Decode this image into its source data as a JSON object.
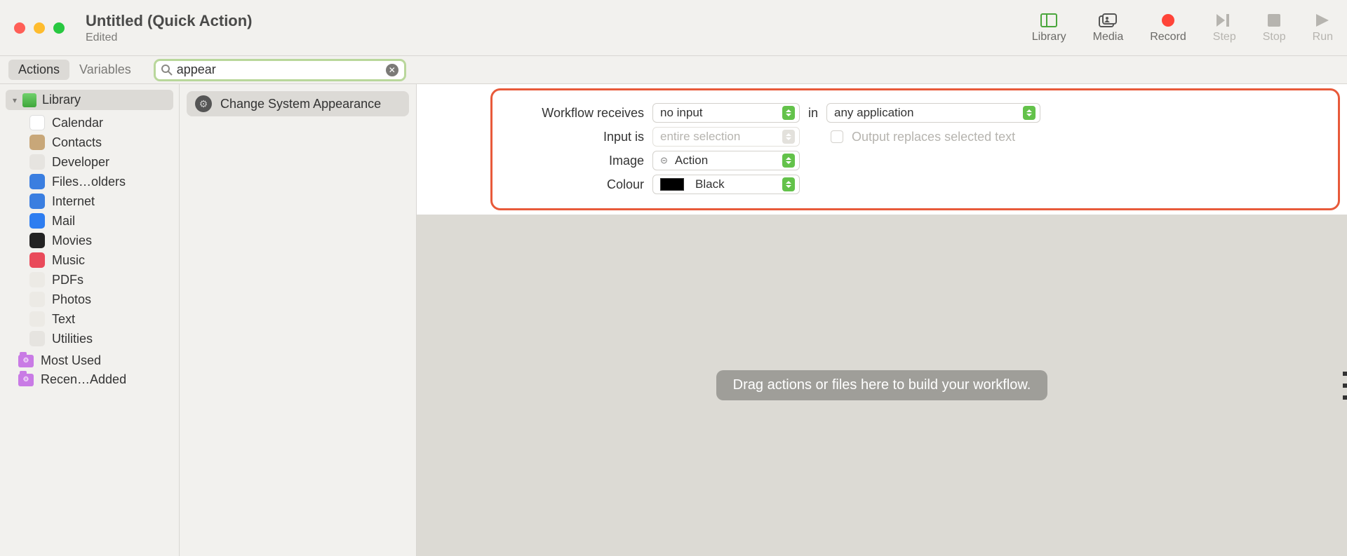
{
  "window": {
    "title": "Untitled (Quick Action)",
    "subtitle": "Edited"
  },
  "toolbar": {
    "library": "Library",
    "media": "Media",
    "record": "Record",
    "step": "Step",
    "stop": "Stop",
    "run": "Run"
  },
  "tabs": {
    "actions": "Actions",
    "variables": "Variables"
  },
  "search": {
    "value": "appear"
  },
  "sidebar": {
    "library_label": "Library",
    "categories": [
      {
        "label": "Calendar",
        "icon": "cal"
      },
      {
        "label": "Contacts",
        "icon": "con"
      },
      {
        "label": "Developer",
        "icon": "dev"
      },
      {
        "label": "Files…olders",
        "icon": "fil"
      },
      {
        "label": "Internet",
        "icon": "int"
      },
      {
        "label": "Mail",
        "icon": "mai"
      },
      {
        "label": "Movies",
        "icon": "mov"
      },
      {
        "label": "Music",
        "icon": "mus"
      },
      {
        "label": "PDFs",
        "icon": "pdf"
      },
      {
        "label": "Photos",
        "icon": "pho"
      },
      {
        "label": "Text",
        "icon": "txt"
      },
      {
        "label": "Utilities",
        "icon": "uti"
      }
    ],
    "smart": [
      {
        "label": "Most Used"
      },
      {
        "label": "Recen…Added"
      }
    ]
  },
  "actions": {
    "results": [
      {
        "label": "Change System Appearance"
      }
    ]
  },
  "config": {
    "rows": {
      "workflow_receives": {
        "label": "Workflow receives",
        "value": "no input",
        "after": "in",
        "value2": "any application"
      },
      "input_is": {
        "label": "Input is",
        "value": "entire selection",
        "checkbox_label": "Output replaces selected text"
      },
      "image": {
        "label": "Image",
        "value": "Action"
      },
      "colour": {
        "label": "Colour",
        "value": "Black",
        "swatch": "#000000"
      }
    }
  },
  "canvas": {
    "drop_hint": "Drag actions or files here to build your workflow."
  }
}
